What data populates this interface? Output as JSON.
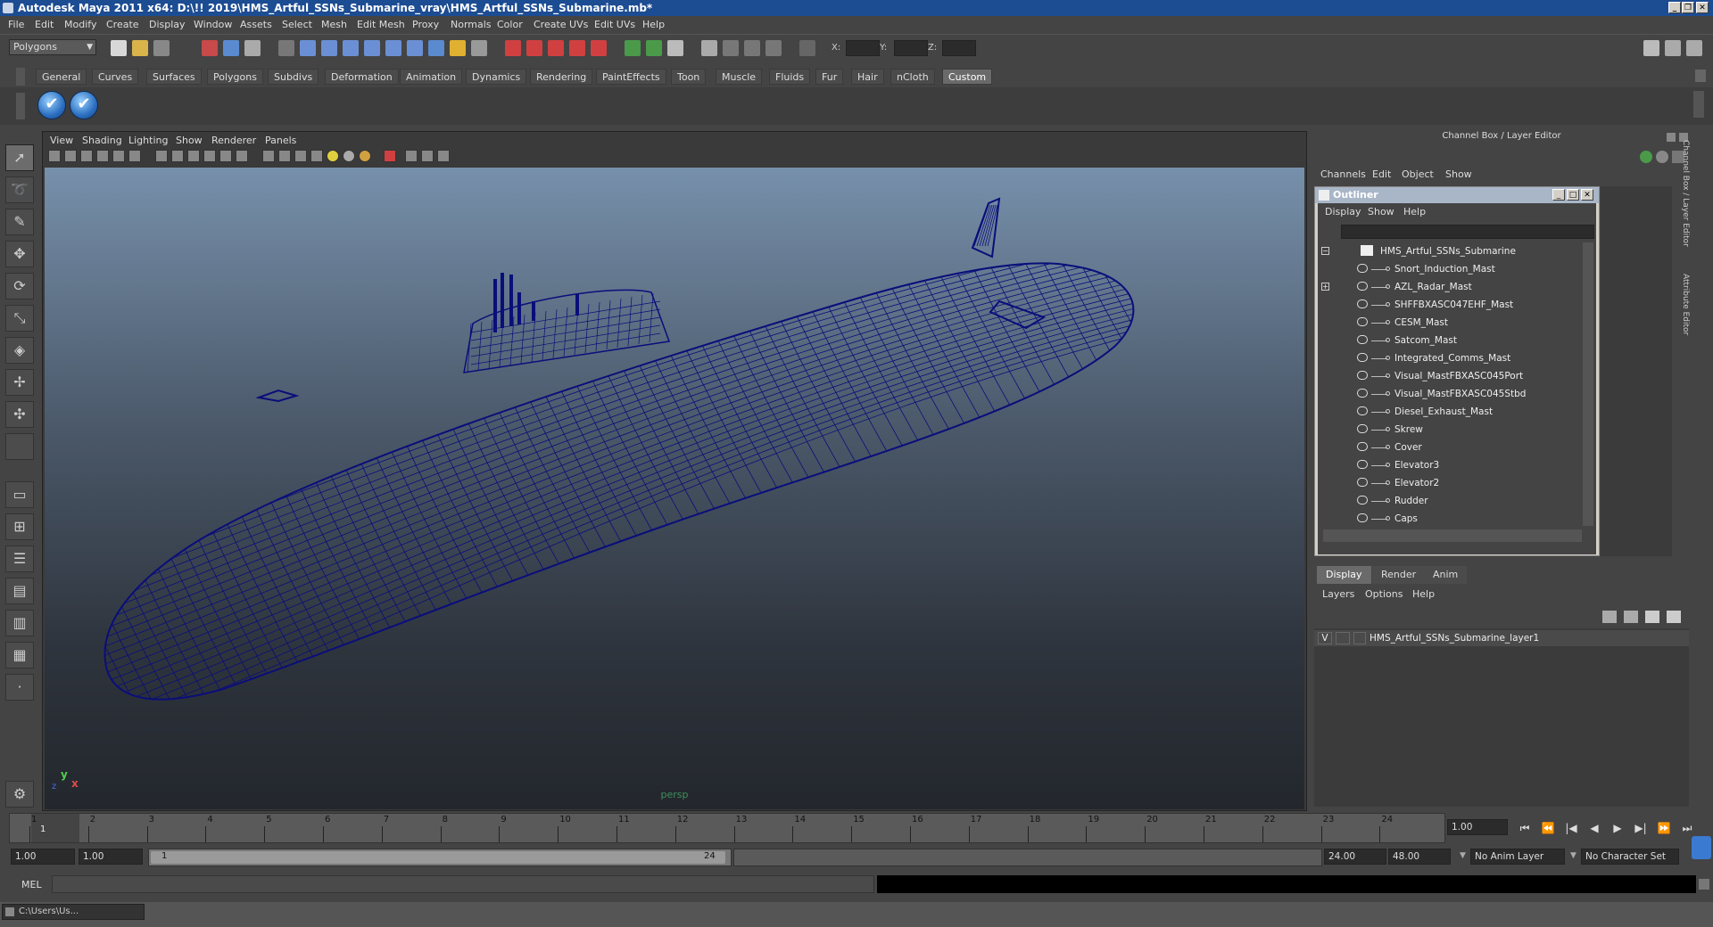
{
  "window": {
    "title": "Autodesk Maya 2011 x64: D:\\!! 2019\\HMS_Artful_SSNs_Submarine_vray\\HMS_Artful_SSNs_Submarine.mb*"
  },
  "menubar": [
    "File",
    "Edit",
    "Modify",
    "Create",
    "Display",
    "Window",
    "Assets",
    "Select",
    "Mesh",
    "Edit Mesh",
    "Proxy",
    "Normals",
    "Color",
    "Create UVs",
    "Edit UVs",
    "Help"
  ],
  "statusline": {
    "mode": "Polygons",
    "x_label": "X:",
    "y_label": "Y:",
    "z_label": "Z:"
  },
  "shelf": {
    "tabs": [
      "General",
      "Curves",
      "Surfaces",
      "Polygons",
      "Subdivs",
      "Deformation",
      "Animation",
      "Dynamics",
      "Rendering",
      "PaintEffects",
      "Toon",
      "Muscle",
      "Fluids",
      "Fur",
      "Hair",
      "nCloth",
      "Custom"
    ],
    "active_tab": "Custom",
    "button_glyph": "✔"
  },
  "viewport": {
    "menu": [
      "View",
      "Shading",
      "Lighting",
      "Show",
      "Renderer",
      "Panels"
    ],
    "camera_label": "persp",
    "axis": {
      "y": "y",
      "x": "x",
      "z": "z"
    },
    "wire_color": "#0a0e7a"
  },
  "channel_box": {
    "title": "Channel Box / Layer Editor",
    "menu": [
      "Channels",
      "Edit",
      "Object",
      "Show"
    ],
    "side_tabs": [
      "Channel Box / Layer Editor",
      "Attribute Editor"
    ]
  },
  "outliner": {
    "title": "Outliner",
    "menu": [
      "Display",
      "Show",
      "Help"
    ],
    "root": "HMS_Artful_SSNs_Submarine",
    "items": [
      "Snort_Induction_Mast",
      "AZL_Radar_Mast",
      "SHFFBXASC047EHF_Mast",
      "CESM_Mast",
      "Satcom_Mast",
      "Integrated_Comms_Mast",
      "Visual_MastFBXASC045Port",
      "Visual_MastFBXASC045Stbd",
      "Diesel_Exhaust_Mast",
      "Skrew",
      "Cover",
      "Elevator3",
      "Elevator2",
      "Rudder",
      "Caps"
    ]
  },
  "layer_editor": {
    "tabs": [
      "Display",
      "Render",
      "Anim"
    ],
    "active_tab": "Display",
    "menu": [
      "Layers",
      "Options",
      "Help"
    ],
    "layer": {
      "visible": "V",
      "name": "HMS_Artful_SSNs_Submarine_layer1"
    }
  },
  "timeline": {
    "ticks": [
      "1",
      "2",
      "3",
      "4",
      "5",
      "6",
      "7",
      "8",
      "9",
      "10",
      "11",
      "12",
      "13",
      "14",
      "15",
      "16",
      "17",
      "18",
      "19",
      "20",
      "21",
      "22",
      "23",
      "24"
    ],
    "current_frame_marker": "1",
    "current_time": "1.00",
    "range": {
      "start": "1.00",
      "playback_start": "1.00",
      "slider_start": "1",
      "slider_end": "24",
      "playback_end": "24.00",
      "end": "48.00",
      "anim_layer": "No Anim Layer",
      "character_set": "No Character Set"
    },
    "playback_buttons": [
      "⏮",
      "⏪",
      "|◀",
      "◀",
      "▶",
      "▶|",
      "⏩",
      "⏭"
    ]
  },
  "command_line": {
    "label": "MEL"
  },
  "taskbar": {
    "window_label": "C:\\Users\\Us..."
  }
}
